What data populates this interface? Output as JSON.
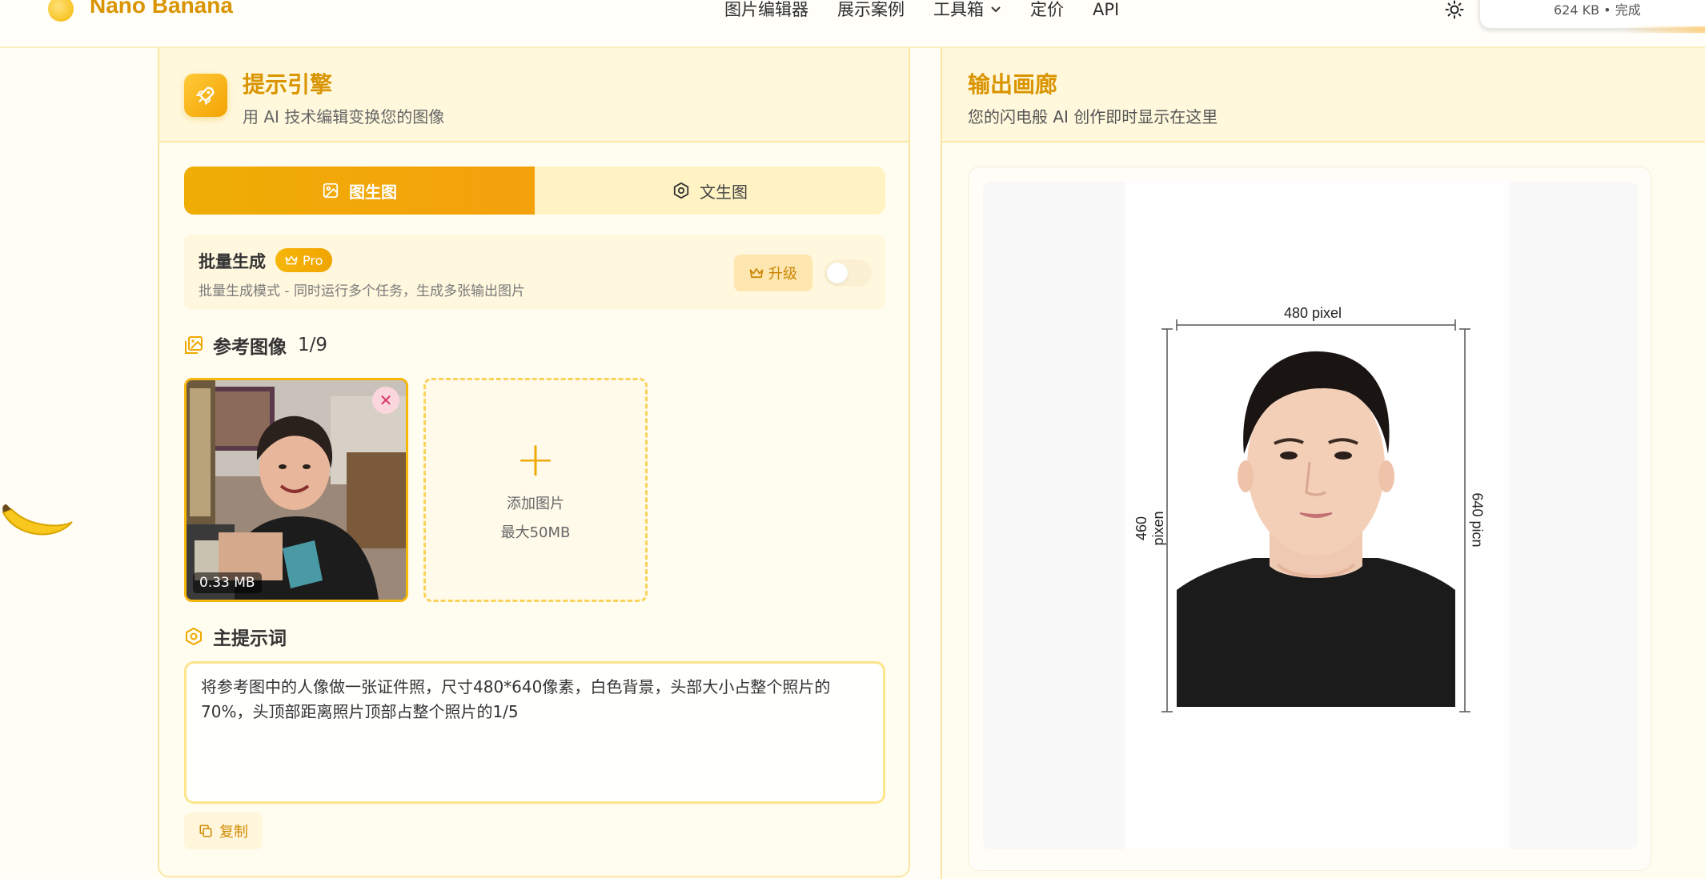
{
  "brand": {
    "name": "Nano Banana",
    "logo_icon": "banana-coin-icon"
  },
  "nav": {
    "items": [
      "图片编辑器",
      "展示案例",
      "工具箱",
      "定价",
      "API"
    ],
    "theme_icon": "sun-icon"
  },
  "download_card": {
    "status": "624 KB • 完成"
  },
  "prompt_engine": {
    "title": "提示引擎",
    "subtitle": "用 AI 技术编辑变换您的图像",
    "tabs": [
      {
        "label": "图生图",
        "active": true
      },
      {
        "label": "文生图",
        "active": false
      }
    ],
    "batch": {
      "title": "批量生成",
      "badge": "Pro",
      "description": "批量生成模式 - 同时运行多个任务，生成多张输出图片",
      "upgrade_label": "升级",
      "toggle_on": false
    },
    "reference": {
      "title": "参考图像",
      "count": "1/9",
      "thumb_size": "0.33 MB",
      "add_label": "添加图片",
      "add_max": "最大50MB"
    },
    "prompt": {
      "title": "主提示词",
      "text": "将参考图中的人像做一张证件照，尺寸480*640像素，白色背景，头部大小占整个照片的70%，头顶部距离照片顶部占整个照片的1/5",
      "copy_label": "复制"
    }
  },
  "gallery": {
    "title": "输出画廊",
    "subtitle": "您的闪电般 AI 创作即时显示在这里",
    "image_annotations": {
      "top": "480 pixel",
      "left": "460 pixen",
      "right": "640 picn"
    }
  },
  "colors": {
    "accent": "#d99400",
    "accent_gradient_start": "#efad05",
    "panel_bg": "#fffcf0",
    "border": "#fbe7a3"
  }
}
